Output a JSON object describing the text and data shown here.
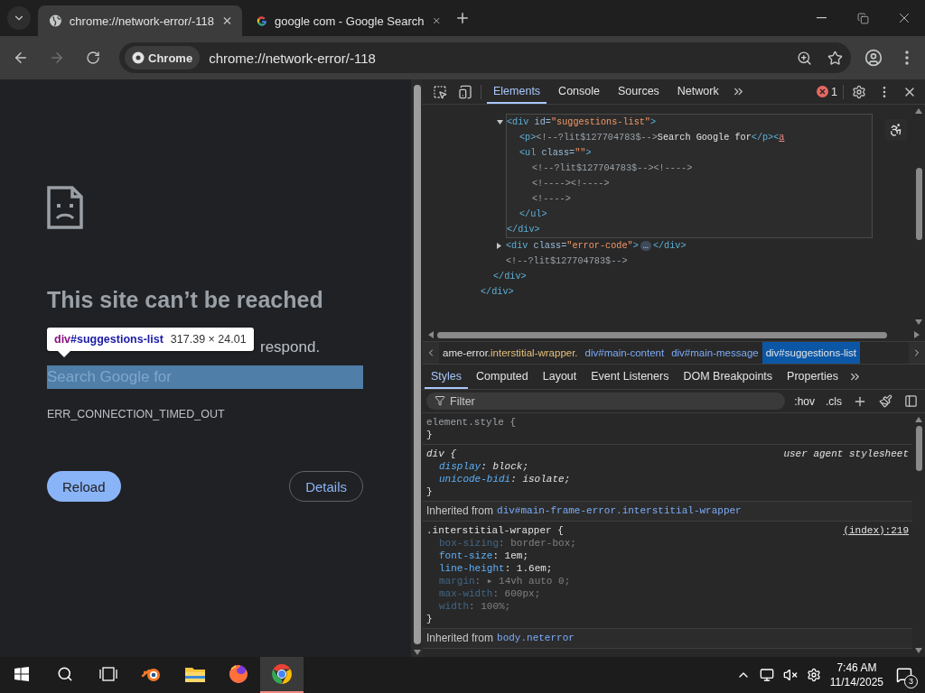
{
  "browser": {
    "tabs": [
      {
        "title": "chrome://network-error/-118",
        "selected": true
      },
      {
        "title": "google com - Google Search",
        "selected": false
      }
    ],
    "nav": [
      {
        "kind": "back",
        "disabled": false
      },
      {
        "kind": "forward",
        "disabled": true
      },
      {
        "kind": "reload",
        "disabled": false
      }
    ],
    "address": {
      "chip": "Chrome",
      "url": "chrome://network-error/-118"
    }
  },
  "page": {
    "heading": "This site can’t be reached",
    "message": "respond.",
    "highlighted_text": "Search Google for",
    "error_code": "ERR_CONNECTION_TIMED_OUT",
    "buttons": [
      {
        "label": "Reload",
        "kind": "primary"
      },
      {
        "label": "Details",
        "kind": "outline"
      }
    ],
    "tooltip": {
      "tag": "div",
      "id": "#suggestions-list",
      "size": "317.39 × 24.01"
    }
  },
  "devtools": {
    "panel_tabs": [
      {
        "label": "Elements",
        "selected": true
      },
      {
        "label": "Console",
        "selected": false
      },
      {
        "label": "Sources",
        "selected": false
      },
      {
        "label": "Network",
        "selected": false
      }
    ],
    "error_count": "1",
    "dom_tree": [
      {
        "close": [
          {
            "kind": "tag",
            "text": "</div>"
          }
        ],
        "children": [
          {
            "close": [
              {
                "kind": "tag",
                "text": "</div>"
              }
            ],
            "children": [
              {
                "open": [
                  {
                    "kind": "tag",
                    "text": "<div"
                  },
                  {
                    "kind": "attr",
                    "text": " id="
                  },
                  {
                    "kind": "value",
                    "text": "\"suggestions-list\""
                  },
                  {
                    "kind": "tag",
                    "text": ">"
                  }
                ],
                "expanded": true,
                "hovered": true,
                "close": [
                  {
                    "kind": "tag",
                    "text": "</div>"
                  }
                ],
                "children": [
                  {
                    "open": [
                      {
                        "kind": "tag",
                        "text": "<p>"
                      },
                      {
                        "kind": "comment",
                        "text": "<!--?lit$127704783$-->"
                      },
                      {
                        "kind": "text",
                        "text": "Search Google for"
                      },
                      {
                        "kind": "tag",
                        "text": "</p><"
                      },
                      {
                        "kind": "error",
                        "text": "a"
                      }
                    ]
                  },
                  {
                    "open": [
                      {
                        "kind": "tag",
                        "text": "<ul"
                      },
                      {
                        "kind": "attr",
                        "text": " class="
                      },
                      {
                        "kind": "value",
                        "text": "\"\""
                      },
                      {
                        "kind": "tag",
                        "text": ">"
                      }
                    ],
                    "close": [
                      {
                        "kind": "tag",
                        "text": "</ul>"
                      }
                    ],
                    "children": [
                      {
                        "open": [
                          {
                            "kind": "comment",
                            "text": "<!--?lit$127704783$--><!---->"
                          }
                        ]
                      },
                      {
                        "open": [
                          {
                            "kind": "comment",
                            "text": "<!----><!---->"
                          }
                        ]
                      },
                      {
                        "open": [
                          {
                            "kind": "comment",
                            "text": "<!---->"
                          }
                        ]
                      }
                    ]
                  }
                ]
              },
              {
                "open": [
                  {
                    "kind": "tag",
                    "text": "<div"
                  },
                  {
                    "kind": "attr",
                    "text": " class="
                  },
                  {
                    "kind": "value",
                    "text": "\"error-code\""
                  },
                  {
                    "kind": "tag",
                    "text": ">"
                  },
                  {
                    "kind": "ellipsis",
                    "text": "…"
                  },
                  {
                    "kind": "tag",
                    "text": "</div>"
                  }
                ],
                "expanded": false,
                "hovered": false
              },
              {
                "open": [
                  {
                    "kind": "comment",
                    "text": "<!--?lit$127704783$-->"
                  }
                ]
              }
            ]
          }
        ]
      }
    ],
    "breadcrumbs": [
      {
        "name": "ame-error",
        "suffix": ".interstitial-wrapper.",
        "selected": false
      },
      {
        "name": "div#main-content",
        "selected": false
      },
      {
        "name": "div#main-message",
        "selected": false
      },
      {
        "name": "div#suggestions-list",
        "selected": true
      }
    ],
    "style_tabs": [
      {
        "label": "Styles",
        "selected": true
      },
      {
        "label": "Computed",
        "selected": false
      },
      {
        "label": "Layout",
        "selected": false
      },
      {
        "label": "Event Listeners",
        "selected": false
      },
      {
        "label": "DOM Breakpoints",
        "selected": false
      },
      {
        "label": "Properties",
        "selected": false
      }
    ],
    "filter": {
      "placeholder": "Filter",
      "toggles": [
        ":hov",
        ".cls"
      ]
    },
    "styles": [
      {
        "kind": "inline_rule",
        "selector": "element.style {",
        "close": "}"
      },
      {
        "kind": "agent_rule",
        "selector": "div {",
        "source": "user agent stylesheet",
        "close": "}",
        "properties": [
          {
            "name": "display",
            "value": ": block;",
            "active": true
          },
          {
            "name": "unicode-bidi",
            "value": ": isolate;",
            "active": true
          }
        ]
      },
      {
        "kind": "inherited",
        "label": "Inherited from",
        "link": "div#main-frame-error.interstitial-wrapper"
      },
      {
        "kind": "author_rule",
        "selector": ".interstitial-wrapper {",
        "source": "(index):219",
        "close": "}",
        "properties": [
          {
            "name": "box-sizing",
            "value": ": border-box;",
            "active": false
          },
          {
            "name": "font-size",
            "value": ": 1em;",
            "active": true
          },
          {
            "name": "line-height",
            "value": ": 1.6em;",
            "active": true
          },
          {
            "name": "margin",
            "value": ": ▸ 14vh auto 0;",
            "active": false
          },
          {
            "name": "max-width",
            "value": ": 600px;",
            "active": false
          },
          {
            "name": "width",
            "value": ": 100%;",
            "active": false
          }
        ]
      },
      {
        "kind": "inherited",
        "label": "Inherited from",
        "link": "body.neterror"
      }
    ]
  },
  "taskbar": {
    "apps": [
      {
        "kind": "ring-logo",
        "active": false
      },
      {
        "kind": "folder",
        "active": false
      },
      {
        "kind": "globe-logo",
        "active": false
      },
      {
        "kind": "circle-logo",
        "active": true
      }
    ],
    "time": "7:46 AM",
    "date": "11/14/2025",
    "notifications": "3"
  }
}
